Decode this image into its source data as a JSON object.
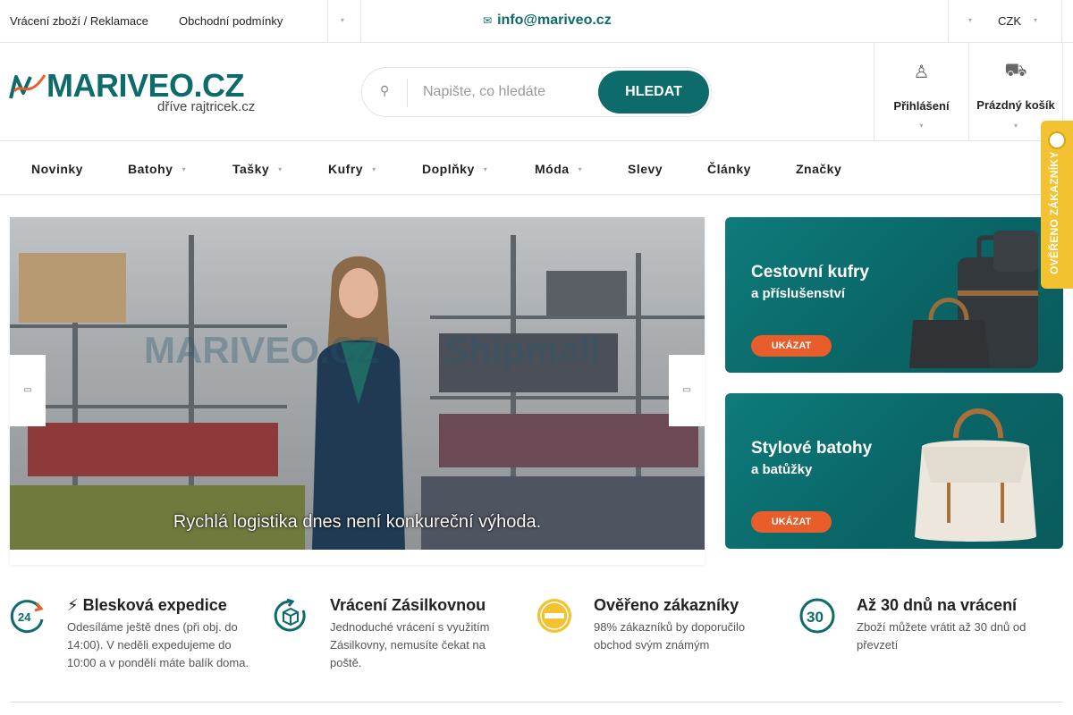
{
  "topbar": {
    "links": [
      "Vrácení zboží / Reklamace",
      "Obchodní podmínky"
    ],
    "email": "info@mariveo.cz",
    "currency": "CZK"
  },
  "header": {
    "logo_name": "MARIVEO.CZ",
    "logo_sub": "dříve rajtricek.cz",
    "search_placeholder": "Napište, co hledáte",
    "search_button": "HLEDAT",
    "login_label": "Přihlášení",
    "cart_label": "Prázdný košík"
  },
  "nav": {
    "items": [
      "Novinky",
      "Batohy",
      "Tašky",
      "Kufry",
      "Doplňky",
      "Móda",
      "Slevy",
      "Články",
      "Značky"
    ]
  },
  "slider": {
    "watermark_left": "MARIVEO.CZ",
    "watermark_right": "Shipmall",
    "caption": "Rychlá logistika dnes není konkureční výhoda."
  },
  "banners": [
    {
      "title": "Cestovní kufry",
      "subtitle": "a příslušenství",
      "button": "UKÁZAT"
    },
    {
      "title": "Stylové batohy",
      "subtitle": "a batůžky",
      "button": "UKÁZAT"
    }
  ],
  "badge": {
    "label": "OVĚŘENO ZÁKAZNÍKY"
  },
  "features": [
    {
      "icon": "clock-24-icon",
      "title": "Blesková expedice",
      "desc": "Odesíláme ještě dnes (při obj. do 14:00). V neděli expedujeme do 10:00 a v pondělí máte balík doma."
    },
    {
      "icon": "return-box-icon",
      "title": "Vrácení Zásilkovnou",
      "desc": "Jednoduché vrácení s využitím Zásilkovny, nemusíte čekat na poště."
    },
    {
      "icon": "verified-seal-icon",
      "title": "Ověřeno zákazníky",
      "desc": "98% zákazníků by doporučilo obchod svým známým"
    },
    {
      "icon": "thirty-days-icon",
      "title": "Až 30 dnů na vrácení",
      "desc": "Zboží můžete vrátit až 30 dnů od převzetí"
    }
  ],
  "colors": {
    "brand": "#0d6b6b",
    "accent": "#e85d2a",
    "badge": "#f2c230"
  }
}
